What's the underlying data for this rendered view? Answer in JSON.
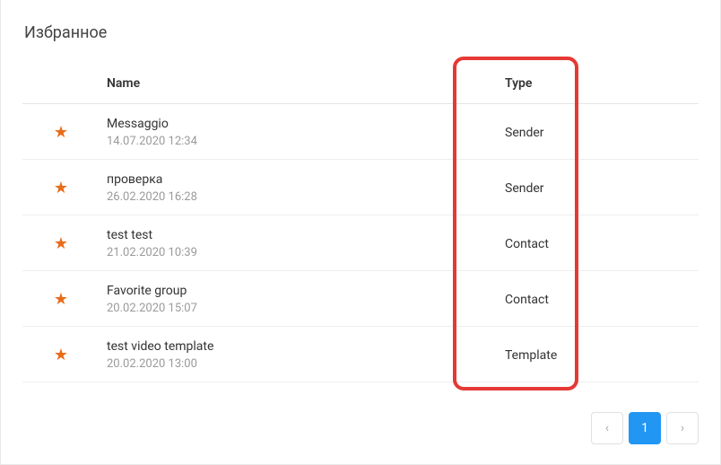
{
  "title": "Избранное",
  "columns": {
    "name": "Name",
    "type": "Type"
  },
  "rows": [
    {
      "name": "Messaggio",
      "date": "14.07.2020 12:34",
      "type": "Sender"
    },
    {
      "name": "проверка",
      "date": "26.02.2020 16:28",
      "type": "Sender"
    },
    {
      "name": "test test",
      "date": "21.02.2020 10:39",
      "type": "Contact"
    },
    {
      "name": "Favorite group",
      "date": "20.02.2020 15:07",
      "type": "Contact"
    },
    {
      "name": "test video template",
      "date": "20.02.2020 13:00",
      "type": "Template"
    }
  ],
  "pagination": {
    "prev": "‹",
    "current": "1",
    "next": "›"
  }
}
